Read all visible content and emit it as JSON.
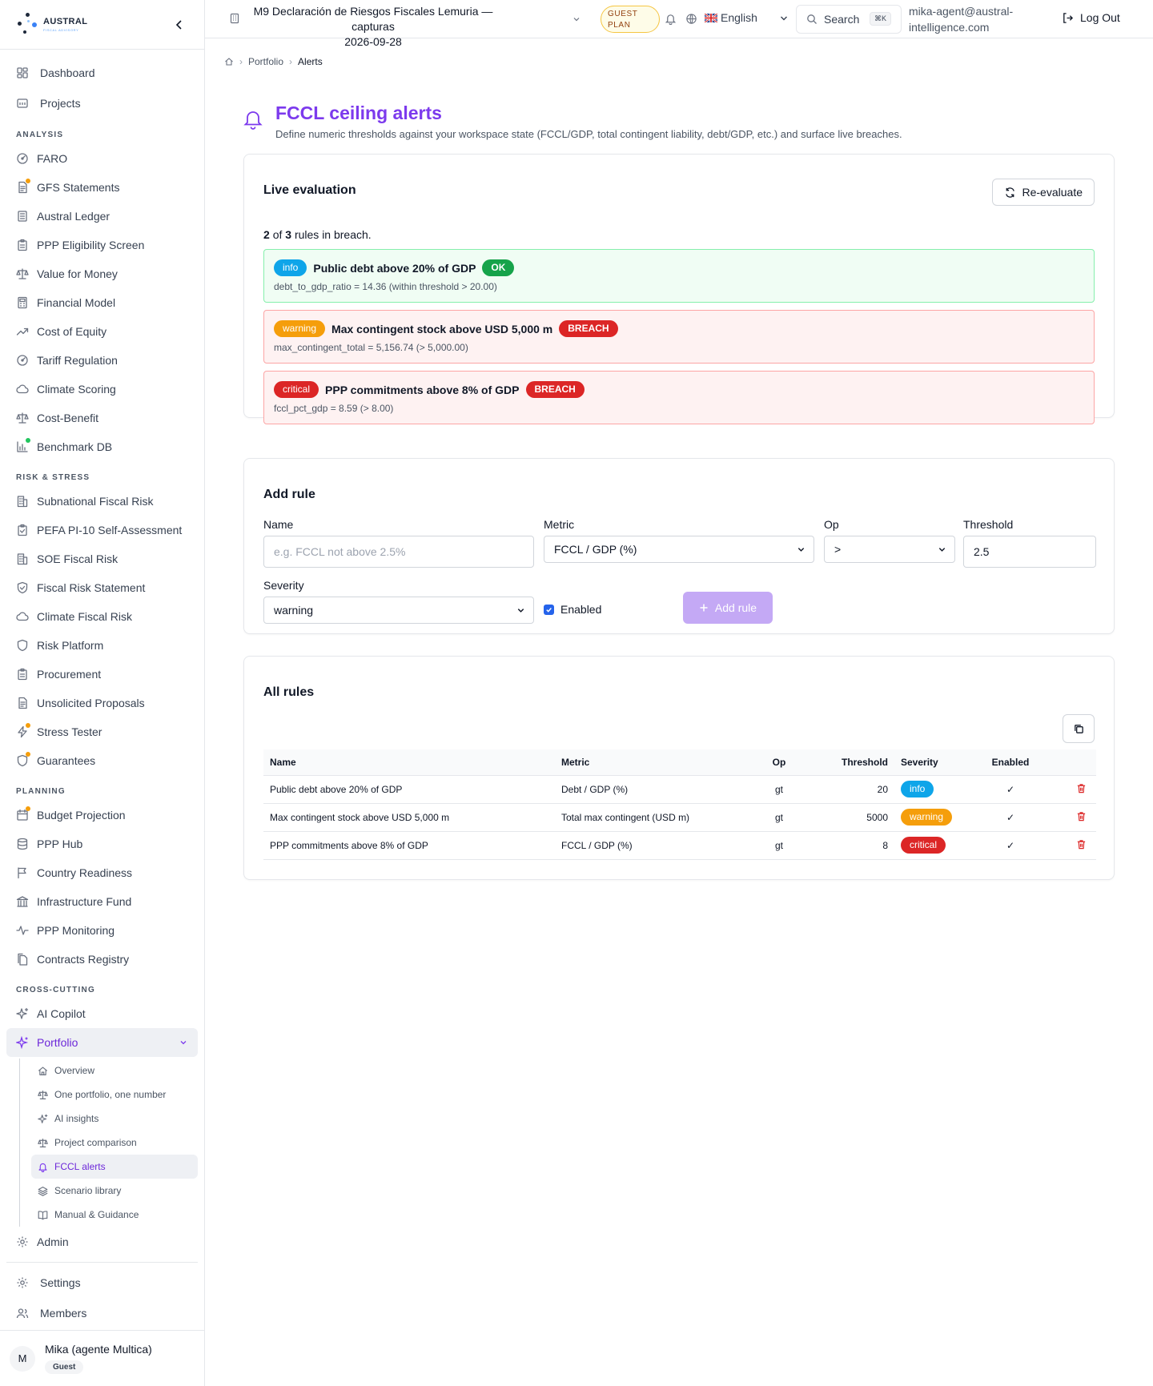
{
  "brand": {
    "name": "AUSTRAL",
    "tagline": "FISCAL ADVISORY"
  },
  "sidebar": {
    "top_items": [
      {
        "label": "Dashboard",
        "icon": "dashboard-icon"
      },
      {
        "label": "Projects",
        "icon": "folder-icon"
      }
    ],
    "sections": [
      {
        "title": "ANALYSIS",
        "items": [
          {
            "label": "FARO",
            "icon": "gauge-icon"
          },
          {
            "label": "GFS Statements",
            "icon": "document-icon",
            "dot": "#f59e0b"
          },
          {
            "label": "Austral Ledger",
            "icon": "ledger-icon"
          },
          {
            "label": "PPP Eligibility Screen",
            "icon": "clipboard-icon"
          },
          {
            "label": "Value for Money",
            "icon": "scales-icon"
          },
          {
            "label": "Financial Model",
            "icon": "calculator-icon"
          },
          {
            "label": "Cost of Equity",
            "icon": "trending-up-icon"
          },
          {
            "label": "Tariff Regulation",
            "icon": "gauge-icon"
          },
          {
            "label": "Climate Scoring",
            "icon": "cloud-icon"
          },
          {
            "label": "Cost-Benefit",
            "icon": "scales-icon"
          },
          {
            "label": "Benchmark DB",
            "icon": "bar-chart-icon",
            "dot": "#22c55e"
          }
        ]
      },
      {
        "title": "RISK & STRESS",
        "items": [
          {
            "label": "Subnational Fiscal Risk",
            "icon": "building-icon"
          },
          {
            "label": "PEFA PI-10 Self-Assessment",
            "icon": "clipboard-check-icon"
          },
          {
            "label": "SOE Fiscal Risk",
            "icon": "building-icon"
          },
          {
            "label": "Fiscal Risk Statement",
            "icon": "shield-check-icon"
          },
          {
            "label": "Climate Fiscal Risk",
            "icon": "cloud-icon"
          },
          {
            "label": "Risk Platform",
            "icon": "shield-icon"
          },
          {
            "label": "Procurement",
            "icon": "clipboard-icon"
          },
          {
            "label": "Unsolicited Proposals",
            "icon": "document-icon"
          },
          {
            "label": "Stress Tester",
            "icon": "bolt-icon",
            "dot": "#f59e0b"
          },
          {
            "label": "Guarantees",
            "icon": "shield-icon",
            "dot": "#f59e0b"
          }
        ]
      },
      {
        "title": "PLANNING",
        "items": [
          {
            "label": "Budget Projection",
            "icon": "calendar-icon",
            "dot": "#f59e0b"
          },
          {
            "label": "PPP Hub",
            "icon": "database-icon"
          },
          {
            "label": "Country Readiness",
            "icon": "flag-icon"
          },
          {
            "label": "Infrastructure Fund",
            "icon": "bank-icon"
          },
          {
            "label": "PPP Monitoring",
            "icon": "activity-icon"
          },
          {
            "label": "Contracts Registry",
            "icon": "documents-icon"
          }
        ]
      },
      {
        "title": "CROSS-CUTTING",
        "items": [
          {
            "label": "AI Copilot",
            "icon": "sparkles-icon"
          }
        ]
      }
    ],
    "portfolio": {
      "label": "Portfolio",
      "subitems": [
        {
          "label": "Overview",
          "icon": "home-icon"
        },
        {
          "label": "One portfolio, one number",
          "icon": "scales-icon"
        },
        {
          "label": "AI insights",
          "icon": "sparkles-icon"
        },
        {
          "label": "Project comparison",
          "icon": "scales-icon"
        },
        {
          "label": "FCCL alerts",
          "icon": "bell-icon",
          "active": true
        },
        {
          "label": "Scenario library",
          "icon": "layers-icon"
        },
        {
          "label": "Manual & Guidance",
          "icon": "book-icon"
        }
      ]
    },
    "admin": {
      "label": "Admin"
    },
    "bottom_items": [
      {
        "label": "Settings",
        "icon": "gear-icon"
      },
      {
        "label": "Members",
        "icon": "users-icon"
      }
    ],
    "user": {
      "initial": "M",
      "name": "Mika (agente Multica)",
      "role": "Guest"
    }
  },
  "topbar": {
    "workspace_line1": "M9 Declaración de Riesgos Fiscales Lemuria — capturas",
    "workspace_line2": "2026-09-28",
    "plan_line1": "GUEST",
    "plan_line2": "PLAN",
    "language": "English",
    "search": "Search",
    "search_kbd": "⌘K",
    "email": "mika-agent@austral-intelligence.com",
    "logout": "Log Out"
  },
  "breadcrumb": {
    "parent": "Portfolio",
    "current": "Alerts"
  },
  "page": {
    "title": "FCCL ceiling alerts",
    "subtitle": "Define numeric thresholds against your workspace state (FCCL/GDP, total contingent liability, debt/GDP, etc.) and surface live breaches."
  },
  "live": {
    "title": "Live evaluation",
    "reevaluate": "Re-evaluate",
    "breach_count": "2",
    "of": "of",
    "rule_count": "3",
    "summary_tail": "rules in breach.",
    "rules": [
      {
        "severity": "info",
        "name": "Public debt above 20% of GDP",
        "status": "OK",
        "expr": "debt_to_gdp_ratio = 14.36 (within threshold > 20.00)"
      },
      {
        "severity": "warning",
        "name": "Max contingent stock above USD 5,000 m",
        "status": "BREACH",
        "expr": "max_contingent_total = 5,156.74 (> 5,000.00)"
      },
      {
        "severity": "critical",
        "name": "PPP commitments above 8% of GDP",
        "status": "BREACH",
        "expr": "fccl_pct_gdp = 8.59 (> 8.00)"
      }
    ]
  },
  "add_rule": {
    "title": "Add rule",
    "name_label": "Name",
    "name_placeholder": "e.g. FCCL not above 2.5%",
    "metric_label": "Metric",
    "metric_value": "FCCL / GDP (%)",
    "op_label": "Op",
    "op_value": ">",
    "threshold_label": "Threshold",
    "threshold_value": "2.5",
    "severity_label": "Severity",
    "severity_value": "warning",
    "enabled_label": "Enabled",
    "submit": "Add rule"
  },
  "all_rules": {
    "title": "All rules",
    "headers": {
      "name": "Name",
      "metric": "Metric",
      "op": "Op",
      "threshold": "Threshold",
      "severity": "Severity",
      "enabled": "Enabled"
    },
    "rows": [
      {
        "name": "Public debt above 20% of GDP",
        "metric": "Debt / GDP (%)",
        "op": "gt",
        "threshold": "20",
        "severity": "info",
        "enabled": "✓"
      },
      {
        "name": "Max contingent stock above USD 5,000 m",
        "metric": "Total max contingent (USD m)",
        "op": "gt",
        "threshold": "5000",
        "severity": "warning",
        "enabled": "✓"
      },
      {
        "name": "PPP commitments above 8% of GDP",
        "metric": "FCCL / GDP (%)",
        "op": "gt",
        "threshold": "8",
        "severity": "critical",
        "enabled": "✓"
      }
    ]
  },
  "colors": {
    "accent": "#7c3aed",
    "ok": "#16a34a",
    "breach": "#dc2626",
    "info": "#0ea5e9",
    "warning": "#f59e0b"
  }
}
